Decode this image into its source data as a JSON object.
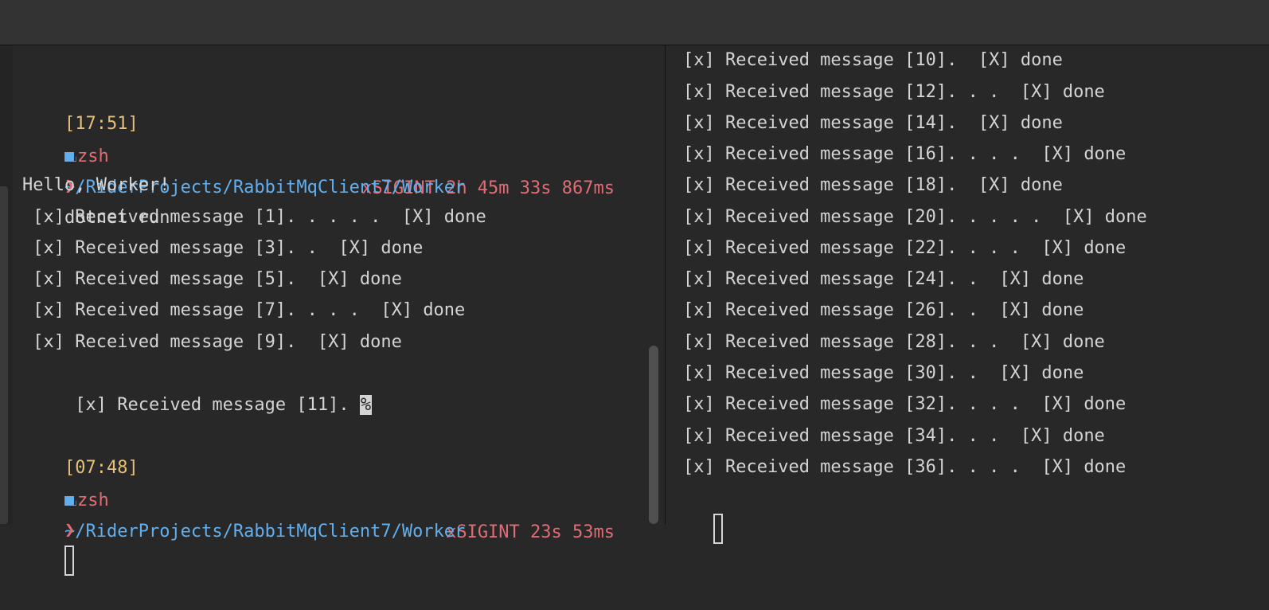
{
  "window": {
    "title": ""
  },
  "left_pane": {
    "session1": {
      "time": "[17:51]",
      "shell_icon": "shell-icon",
      "shell": "zsh",
      "status": "xSIGINT 2h 45m 33s 867ms",
      "folder_icon": "folder-icon",
      "path": "~/RiderProjects/RabbitMqClient7/Worker",
      "prompt": "❯",
      "command": "dotnet run"
    },
    "output": [
      "Hello, Worker!",
      " [x] Received message [1]. . . . .  [X] done",
      " [x] Received message [3]. .  [X] done",
      " [x] Received message [5].  [X] done",
      " [x] Received message [7]. . . .  [X] done",
      " [x] Received message [9].  [X] done"
    ],
    "partial_output": " [x] Received message [11]. ",
    "partial_marker": "%",
    "session2": {
      "time": "[07:48]",
      "shell_icon": "shell-icon",
      "shell": "zsh",
      "status": "xSIGINT 23s 53ms",
      "folder_icon": "folder-icon",
      "path": "~/RiderProjects/RabbitMqClient7/Worker",
      "prompt": "❯"
    }
  },
  "right_pane": {
    "output": [
      "[x] Received message [10].  [X] done",
      "[x] Received message [12]. . .  [X] done",
      "[x] Received message [14].  [X] done",
      "[x] Received message [16]. . . .  [X] done",
      "[x] Received message [18].  [X] done",
      "[x] Received message [20]. . . . .  [X] done",
      "[x] Received message [22]. . . .  [X] done",
      "[x] Received message [24]. .  [X] done",
      "[x] Received message [26]. .  [X] done",
      "[x] Received message [28]. . .  [X] done",
      "[x] Received message [30]. .  [X] done",
      "[x] Received message [32]. . . .  [X] done",
      "[x] Received message [34]. . .  [X] done",
      "[x] Received message [36]. . . .  [X] done"
    ]
  }
}
